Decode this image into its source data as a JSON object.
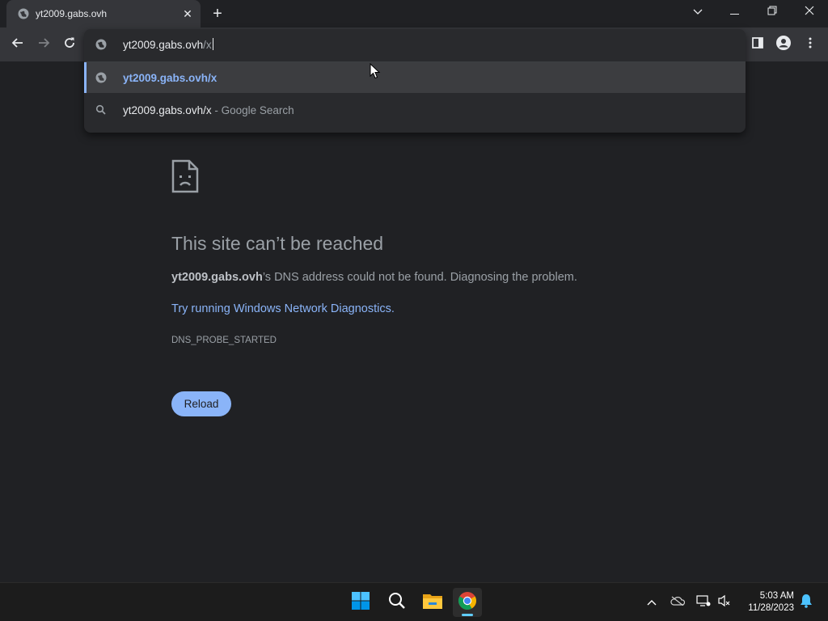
{
  "browser": {
    "tab": {
      "title": "yt2009.gabs.ovh",
      "favicon": "globe-icon"
    },
    "window_controls": [
      "chevron-down-icon",
      "minimize-icon",
      "restore-icon",
      "close-icon"
    ]
  },
  "omnibox": {
    "value_main": "yt2009.gabs.ovh",
    "value_dim": "/x",
    "suggestions": [
      {
        "icon": "globe-icon",
        "text": "yt2009.gabs.ovh/x",
        "suffix": "",
        "selected": true
      },
      {
        "icon": "search-icon",
        "text": "yt2009.gabs.ovh/x",
        "suffix": " - Google Search",
        "selected": false
      }
    ]
  },
  "error_page": {
    "icon": "sad-page-icon",
    "title": "This site can’t be reached",
    "host": "yt2009.gabs.ovh",
    "desc_rest": "’s DNS address could not be found. Diagnosing the problem.",
    "link": "Try running Windows Network Diagnostics.",
    "code": "DNS_PROBE_STARTED",
    "reload_label": "Reload"
  },
  "taskbar": {
    "apps": [
      "windows-start-icon",
      "search-icon",
      "file-explorer-icon",
      "chrome-icon"
    ],
    "tray": [
      "chevron-up-icon",
      "onedrive-icon",
      "network-icon",
      "volume-icon",
      "notifications-icon"
    ],
    "clock": {
      "time": "5:03 AM",
      "date": "11/28/2023"
    }
  },
  "colors": {
    "accent": "#8ab4f8",
    "background": "#202124",
    "toolbar": "#35363a"
  }
}
